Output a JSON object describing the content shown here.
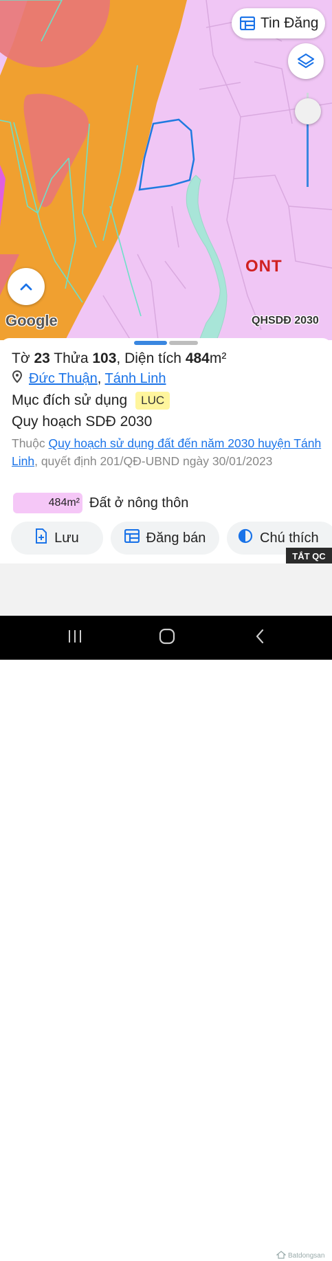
{
  "map": {
    "zone_label": "ONT",
    "attribution": "Google",
    "overlay_label": "QHSDĐ 2030"
  },
  "controls": {
    "post_listing_label": "Tin Đăng",
    "layers_icon": "layers-icon",
    "up_icon": "chevron-up-icon",
    "opacity_slider_value": 0.93
  },
  "parcel": {
    "sheet_label": "Tờ",
    "sheet_number": "23",
    "plot_label": "Thửa",
    "plot_number": "103",
    "area_label": "Diện tích",
    "area_value": "484",
    "area_unit": "m²",
    "ward": "Đức Thuận",
    "separator": ",",
    "district": "Tánh Linh",
    "purpose_label": "Mục đích sử dụng",
    "purpose_code": "LUC",
    "plan_title": "Quy hoạch SDĐ 2030",
    "plan_prefix": "Thuộc",
    "plan_link": "Quy hoạch sử dụng đất đến năm 2030 huyện Tánh Linh",
    "plan_suffix": ", quyết định 201/QĐ-UBND ngày 30/01/2023",
    "land_use_area": "484m²",
    "land_use_name": "Đất ở nông thôn",
    "land_use_color": "#f5c7f7"
  },
  "actions": {
    "save_label": "Lưu",
    "post_label": "Đăng bán",
    "legend_label": "Chú thích"
  },
  "ad_label": "TẮT QC",
  "colors": {
    "accent": "#1a73e8",
    "zone_ont": "#f0c6f5",
    "road": "#f0a030",
    "parcel_outline": "#1f7ae0"
  },
  "watermark": "Batdongsan"
}
